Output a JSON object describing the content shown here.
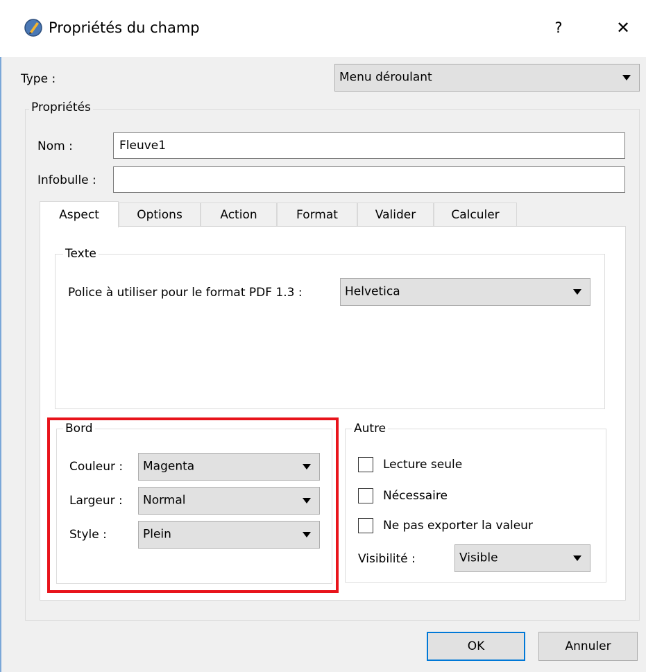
{
  "window": {
    "title": "Propriétés du champ",
    "help_label": "?",
    "close_label": "✕"
  },
  "type": {
    "label": "Type :",
    "value": "Menu déroulant"
  },
  "properties": {
    "title": "Propriétés",
    "name_label": "Nom :",
    "name_value": "Fleuve1",
    "tooltip_label": "Infobulle :",
    "tooltip_value": ""
  },
  "tabs": [
    {
      "label": "Aspect",
      "active": true
    },
    {
      "label": "Options"
    },
    {
      "label": "Action"
    },
    {
      "label": "Format"
    },
    {
      "label": "Valider"
    },
    {
      "label": "Calculer"
    }
  ],
  "text_group": {
    "title": "Texte",
    "font_label": "Police à utiliser pour le format PDF 1.3 :",
    "font_value": "Helvetica"
  },
  "border_group": {
    "title": "Bord",
    "color_label": "Couleur :",
    "color_value": "Magenta",
    "width_label": "Largeur :",
    "width_value": "Normal",
    "style_label": "Style :",
    "style_value": "Plein"
  },
  "other_group": {
    "title": "Autre",
    "readonly_label": "Lecture seule",
    "required_label": "Nécessaire",
    "noexport_label": "Ne pas exporter la valeur",
    "visibility_label": "Visibilité :",
    "visibility_value": "Visible"
  },
  "buttons": {
    "ok": "OK",
    "cancel": "Annuler"
  },
  "colors": {
    "highlight": "#e8141b",
    "default_button_border": "#0078d7"
  }
}
